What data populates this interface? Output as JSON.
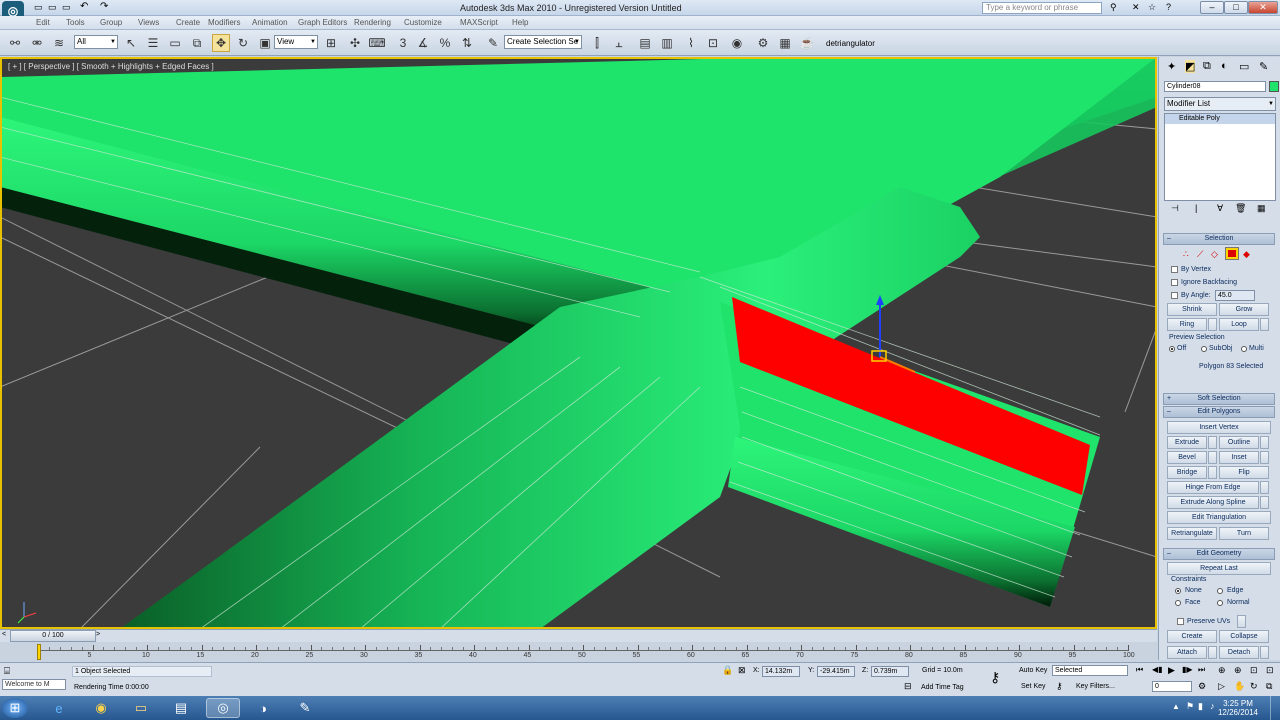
{
  "window": {
    "title": "Autodesk 3ds Max 2010    - Unregistered Version    Untitled",
    "search_placeholder": "Type a keyword or phrase"
  },
  "menu": [
    "Edit",
    "Tools",
    "Group",
    "Views",
    "Create",
    "Modifiers",
    "Animation",
    "Graph Editors",
    "Rendering",
    "Customize",
    "MAXScript",
    "Help"
  ],
  "toolbar": {
    "filter_value": "All",
    "ref_coord_value": "View",
    "named_selection_value": "Create Selection Se",
    "detriangulator_label": "detriangulator"
  },
  "viewport": {
    "label": "[ + ] [ Perspective ] [ Smooth + Highlights + Edged Faces ]"
  },
  "command_panel": {
    "object_name": "Cylinder08",
    "modifier_list_label": "Modifier List",
    "stack_item": "Editable Poly",
    "selection": {
      "header": "Selection",
      "by_vertex": "By Vertex",
      "ignore_backfacing": "Ignore Backfacing",
      "by_angle": "By Angle:",
      "by_angle_value": "45.0",
      "shrink": "Shrink",
      "grow": "Grow",
      "ring": "Ring",
      "loop": "Loop",
      "preview_selection": "Preview Selection",
      "preview_off": "Off",
      "preview_subobj": "SubObj",
      "preview_multi": "Multi",
      "status": "Polygon 83 Selected"
    },
    "soft_selection": "Soft Selection",
    "edit_polygons": {
      "header": "Edit Polygons",
      "insert_vertex": "Insert Vertex",
      "extrude": "Extrude",
      "outline": "Outline",
      "bevel": "Bevel",
      "inset": "Inset",
      "bridge": "Bridge",
      "flip": "Flip",
      "hinge_from_edge": "Hinge From Edge",
      "extrude_along_spline": "Extrude Along Spline",
      "edit_triangulation": "Edit Triangulation",
      "retriangulate": "Retriangulate",
      "turn": "Turn"
    },
    "edit_geometry": {
      "header": "Edit Geometry",
      "repeat_last": "Repeat Last",
      "constraints": "Constraints",
      "none": "None",
      "edge": "Edge",
      "face": "Face",
      "normal": "Normal",
      "preserve_uvs": "Preserve UVs",
      "create": "Create",
      "collapse": "Collapse",
      "attach": "Attach",
      "detach": "Detach"
    }
  },
  "timeline": {
    "frame_counter": "0 / 100",
    "ticks": [
      "5",
      "10",
      "15",
      "20",
      "25",
      "30",
      "35",
      "40",
      "45",
      "50",
      "55",
      "60",
      "65",
      "70",
      "75",
      "80",
      "85",
      "90",
      "95",
      "100"
    ],
    "current_frame_fraction": 0.0
  },
  "status": {
    "listener_text": "Welcome to M",
    "objects_selected": "1 Object Selected",
    "rendering_time": "Rendering Time  0:00:00",
    "x_label": "X:",
    "x_value": "14.132m",
    "y_label": "Y:",
    "y_value": "-29.415m",
    "z_label": "Z:",
    "z_value": "0.739m",
    "grid": "Grid = 10.0m",
    "add_time_tag": "Add Time Tag",
    "auto_key": "Auto Key",
    "set_key": "Set Key",
    "key_mode_value": "Selected",
    "key_filters": "Key Filters...",
    "frame_value": "0"
  },
  "taskbar": {
    "time": "3:25 PM",
    "date": "12/26/2014"
  },
  "colors": {
    "pipe_green": "#1fe36a",
    "selection_red": "#ff0000",
    "viewport_bg": "#3b3b3b",
    "active_border": "#e6c200"
  }
}
